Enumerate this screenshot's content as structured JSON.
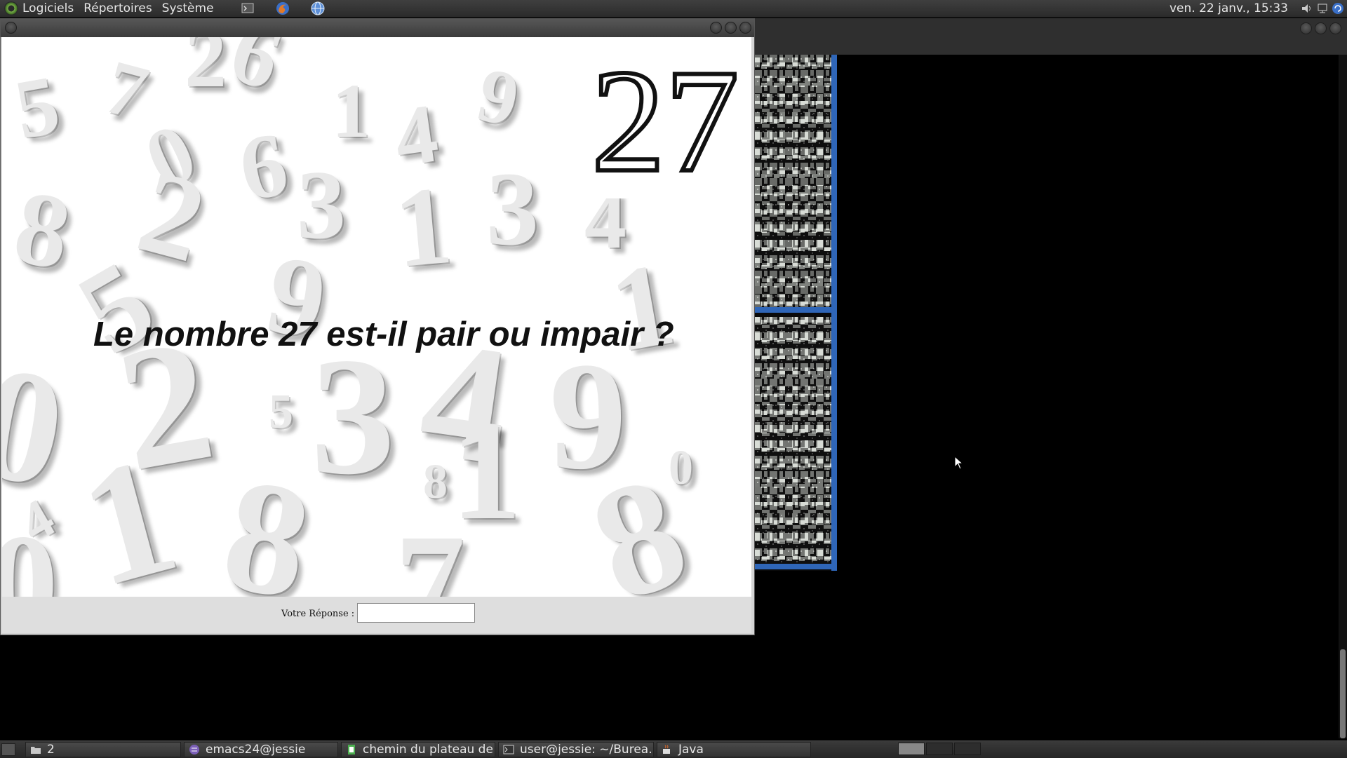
{
  "top_panel": {
    "menus": [
      "Logiciels",
      "Répertoires",
      "Système"
    ],
    "clock": "ven. 22 janv., 15:33",
    "tray_icons": [
      "volume-icon",
      "network-icon",
      "update-icon"
    ]
  },
  "app": {
    "big_number": "27",
    "question": "Le nombre 27 est-il pair ou impair ?",
    "answer_label": "Votre Réponse :",
    "answer_value": ""
  },
  "taskbar": {
    "tasks": [
      {
        "label": "2",
        "icon": "folder-icon"
      },
      {
        "label": "emacs24@jessie",
        "icon": "emacs-icon"
      },
      {
        "label": "chemin du plateau de ...",
        "icon": "document-icon"
      },
      {
        "label": "user@jessie: ~/Burea...",
        "icon": "terminal-icon"
      },
      {
        "label": "Java",
        "icon": "java-icon"
      }
    ]
  },
  "colors": {
    "panel_bg": "#2f2f2f",
    "accent_blue": "#2f66b8",
    "text_dark": "#111111"
  }
}
